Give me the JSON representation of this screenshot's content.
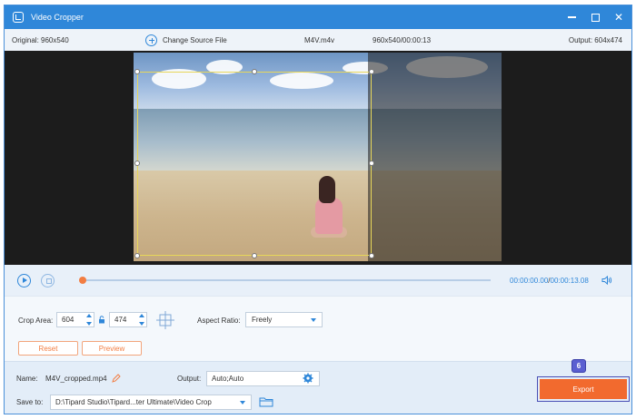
{
  "window": {
    "title": "Video Cropper",
    "controls": {
      "minimize_icon": "minimize-icon",
      "maximize_icon": "maximize-icon",
      "close_icon": "close-icon",
      "close_glyph": "✕"
    }
  },
  "infobar": {
    "original": "Original: 960x540",
    "change_source": "Change Source File",
    "filename": "M4V.m4v",
    "meta": "960x540/00:00:13",
    "output": "Output: 604x474"
  },
  "playback": {
    "current_time": "00:00:00.00",
    "separator": "/",
    "total_time": "00:00:13.08",
    "progress": 0.0
  },
  "crop": {
    "area_label": "Crop Area:",
    "width": "604",
    "height": "474",
    "aspect_label": "Aspect Ratio:",
    "aspect_value": "Freely",
    "reset_label": "Reset",
    "preview_label": "Preview"
  },
  "output_panel": {
    "name_label": "Name:",
    "name_value": "M4V_cropped.mp4",
    "output_label": "Output:",
    "output_value": "Auto;Auto",
    "save_label": "Save to:",
    "save_path": "D:\\Tipard Studio\\Tipard...ter Ultimate\\Video Crop",
    "export_label": "Export",
    "step_badge": "6"
  },
  "colors": {
    "accent": "#2f87d9",
    "export": "#f26a2e",
    "crop_border": "#e8d75a",
    "badge": "#5a5fd1"
  }
}
